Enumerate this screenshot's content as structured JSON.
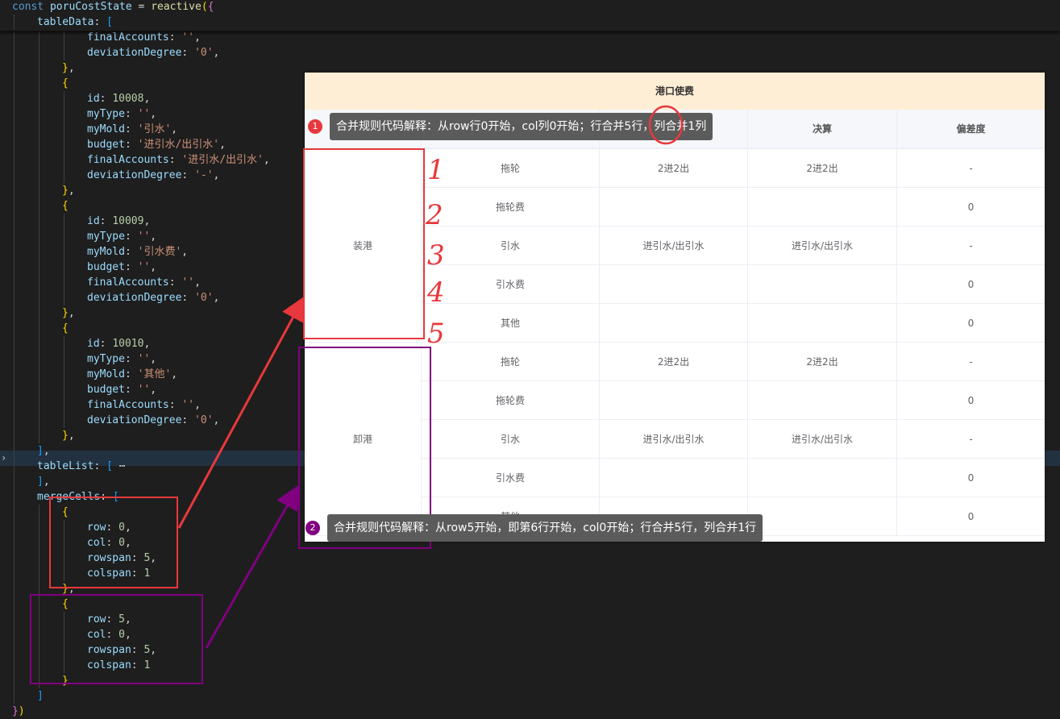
{
  "editor": {
    "lines": [
      {
        "indent": 0,
        "tokens": [
          [
            "kw",
            "const "
          ],
          [
            "var",
            "poruCostState"
          ],
          [
            "pun",
            " = "
          ],
          [
            "fn",
            "reactive"
          ],
          [
            "b1",
            "("
          ],
          [
            "b2",
            "{"
          ]
        ]
      },
      {
        "indent": 1,
        "tokens": [
          [
            "var",
            "tableData"
          ],
          [
            "pun",
            ": "
          ],
          [
            "b3",
            "["
          ]
        ]
      },
      {
        "indent": 3,
        "tokens": [
          [
            "var",
            "finalAccounts"
          ],
          [
            "pun",
            ": "
          ],
          [
            "str",
            "''"
          ],
          [
            "pun",
            ","
          ]
        ]
      },
      {
        "indent": 3,
        "tokens": [
          [
            "var",
            "deviationDegree"
          ],
          [
            "pun",
            ": "
          ],
          [
            "str",
            "'0'"
          ],
          [
            "pun",
            ","
          ]
        ]
      },
      {
        "indent": 2,
        "tokens": [
          [
            "b1",
            "}"
          ],
          [
            "pun",
            ","
          ]
        ]
      },
      {
        "indent": 2,
        "tokens": [
          [
            "b1",
            "{"
          ]
        ]
      },
      {
        "indent": 3,
        "tokens": [
          [
            "var",
            "id"
          ],
          [
            "pun",
            ": "
          ],
          [
            "num",
            "10008"
          ],
          [
            "pun",
            ","
          ]
        ]
      },
      {
        "indent": 3,
        "tokens": [
          [
            "var",
            "myType"
          ],
          [
            "pun",
            ": "
          ],
          [
            "str",
            "''"
          ],
          [
            "pun",
            ","
          ]
        ]
      },
      {
        "indent": 3,
        "tokens": [
          [
            "var",
            "myMold"
          ],
          [
            "pun",
            ": "
          ],
          [
            "str",
            "'引水'"
          ],
          [
            "pun",
            ","
          ]
        ]
      },
      {
        "indent": 3,
        "tokens": [
          [
            "var",
            "budget"
          ],
          [
            "pun",
            ": "
          ],
          [
            "str",
            "'进引水/出引水'"
          ],
          [
            "pun",
            ","
          ]
        ]
      },
      {
        "indent": 3,
        "tokens": [
          [
            "var",
            "finalAccounts"
          ],
          [
            "pun",
            ": "
          ],
          [
            "str",
            "'进引水/出引水'"
          ],
          [
            "pun",
            ","
          ]
        ]
      },
      {
        "indent": 3,
        "tokens": [
          [
            "var",
            "deviationDegree"
          ],
          [
            "pun",
            ": "
          ],
          [
            "str",
            "'-'"
          ],
          [
            "pun",
            ","
          ]
        ]
      },
      {
        "indent": 2,
        "tokens": [
          [
            "b1",
            "}"
          ],
          [
            "pun",
            ","
          ]
        ]
      },
      {
        "indent": 2,
        "tokens": [
          [
            "b1",
            "{"
          ]
        ]
      },
      {
        "indent": 3,
        "tokens": [
          [
            "var",
            "id"
          ],
          [
            "pun",
            ": "
          ],
          [
            "num",
            "10009"
          ],
          [
            "pun",
            ","
          ]
        ]
      },
      {
        "indent": 3,
        "tokens": [
          [
            "var",
            "myType"
          ],
          [
            "pun",
            ": "
          ],
          [
            "str",
            "''"
          ],
          [
            "pun",
            ","
          ]
        ]
      },
      {
        "indent": 3,
        "tokens": [
          [
            "var",
            "myMold"
          ],
          [
            "pun",
            ": "
          ],
          [
            "str",
            "'引水费'"
          ],
          [
            "pun",
            ","
          ]
        ]
      },
      {
        "indent": 3,
        "tokens": [
          [
            "var",
            "budget"
          ],
          [
            "pun",
            ": "
          ],
          [
            "str",
            "''"
          ],
          [
            "pun",
            ","
          ]
        ]
      },
      {
        "indent": 3,
        "tokens": [
          [
            "var",
            "finalAccounts"
          ],
          [
            "pun",
            ": "
          ],
          [
            "str",
            "''"
          ],
          [
            "pun",
            ","
          ]
        ]
      },
      {
        "indent": 3,
        "tokens": [
          [
            "var",
            "deviationDegree"
          ],
          [
            "pun",
            ": "
          ],
          [
            "str",
            "'0'"
          ],
          [
            "pun",
            ","
          ]
        ]
      },
      {
        "indent": 2,
        "tokens": [
          [
            "b1",
            "}"
          ],
          [
            "pun",
            ","
          ]
        ]
      },
      {
        "indent": 2,
        "tokens": [
          [
            "b1",
            "{"
          ]
        ]
      },
      {
        "indent": 3,
        "tokens": [
          [
            "var",
            "id"
          ],
          [
            "pun",
            ": "
          ],
          [
            "num",
            "10010"
          ],
          [
            "pun",
            ","
          ]
        ]
      },
      {
        "indent": 3,
        "tokens": [
          [
            "var",
            "myType"
          ],
          [
            "pun",
            ": "
          ],
          [
            "str",
            "''"
          ],
          [
            "pun",
            ","
          ]
        ]
      },
      {
        "indent": 3,
        "tokens": [
          [
            "var",
            "myMold"
          ],
          [
            "pun",
            ": "
          ],
          [
            "str",
            "'其他'"
          ],
          [
            "pun",
            ","
          ]
        ]
      },
      {
        "indent": 3,
        "tokens": [
          [
            "var",
            "budget"
          ],
          [
            "pun",
            ": "
          ],
          [
            "str",
            "''"
          ],
          [
            "pun",
            ","
          ]
        ]
      },
      {
        "indent": 3,
        "tokens": [
          [
            "var",
            "finalAccounts"
          ],
          [
            "pun",
            ": "
          ],
          [
            "str",
            "''"
          ],
          [
            "pun",
            ","
          ]
        ]
      },
      {
        "indent": 3,
        "tokens": [
          [
            "var",
            "deviationDegree"
          ],
          [
            "pun",
            ": "
          ],
          [
            "str",
            "'0'"
          ],
          [
            "pun",
            ","
          ]
        ]
      },
      {
        "indent": 2,
        "tokens": [
          [
            "b1",
            "}"
          ],
          [
            "pun",
            ","
          ]
        ]
      },
      {
        "indent": 1,
        "tokens": [
          [
            "b3",
            "]"
          ],
          [
            "pun",
            ","
          ]
        ]
      },
      {
        "indent": 1,
        "tokens": [
          [
            "var",
            "tableList"
          ],
          [
            "pun",
            ": "
          ],
          [
            "b3",
            "["
          ],
          [
            "pun",
            " ⋯"
          ]
        ]
      },
      {
        "indent": 1,
        "tokens": [
          [
            "b3",
            "]"
          ],
          [
            "pun",
            ","
          ]
        ]
      },
      {
        "indent": 1,
        "tokens": [
          [
            "var",
            "mergeCells"
          ],
          [
            "pun",
            ": "
          ],
          [
            "b3",
            "["
          ]
        ]
      },
      {
        "indent": 2,
        "tokens": [
          [
            "b1",
            "{"
          ]
        ]
      },
      {
        "indent": 3,
        "tokens": [
          [
            "var",
            "row"
          ],
          [
            "pun",
            ": "
          ],
          [
            "num",
            "0"
          ],
          [
            "pun",
            ","
          ]
        ]
      },
      {
        "indent": 3,
        "tokens": [
          [
            "var",
            "col"
          ],
          [
            "pun",
            ": "
          ],
          [
            "num",
            "0"
          ],
          [
            "pun",
            ","
          ]
        ]
      },
      {
        "indent": 3,
        "tokens": [
          [
            "var",
            "rowspan"
          ],
          [
            "pun",
            ": "
          ],
          [
            "num",
            "5"
          ],
          [
            "pun",
            ","
          ]
        ]
      },
      {
        "indent": 3,
        "tokens": [
          [
            "var",
            "colspan"
          ],
          [
            "pun",
            ": "
          ],
          [
            "num",
            "1"
          ]
        ]
      },
      {
        "indent": 2,
        "tokens": [
          [
            "b1",
            "}"
          ],
          [
            "pun",
            ","
          ]
        ]
      },
      {
        "indent": 2,
        "tokens": [
          [
            "b1",
            "{"
          ]
        ]
      },
      {
        "indent": 3,
        "tokens": [
          [
            "var",
            "row"
          ],
          [
            "pun",
            ": "
          ],
          [
            "num",
            "5"
          ],
          [
            "pun",
            ","
          ]
        ]
      },
      {
        "indent": 3,
        "tokens": [
          [
            "var",
            "col"
          ],
          [
            "pun",
            ": "
          ],
          [
            "num",
            "0"
          ],
          [
            "pun",
            ","
          ]
        ]
      },
      {
        "indent": 3,
        "tokens": [
          [
            "var",
            "rowspan"
          ],
          [
            "pun",
            ": "
          ],
          [
            "num",
            "5"
          ],
          [
            "pun",
            ","
          ]
        ]
      },
      {
        "indent": 3,
        "tokens": [
          [
            "var",
            "colspan"
          ],
          [
            "pun",
            ": "
          ],
          [
            "num",
            "1"
          ]
        ]
      },
      {
        "indent": 2,
        "tokens": [
          [
            "b1",
            "}"
          ]
        ]
      },
      {
        "indent": 1,
        "tokens": [
          [
            "b3",
            "]"
          ]
        ]
      },
      {
        "indent": 0,
        "tokens": [
          [
            "b2",
            "}"
          ],
          [
            "b1",
            ")"
          ]
        ]
      }
    ]
  },
  "table": {
    "title": "港口使费",
    "headers": [
      "",
      "",
      "",
      "决算",
      "偏差度"
    ],
    "groups": [
      "装港",
      "卸港"
    ],
    "rows": [
      [
        "拖轮",
        "2进2出",
        "2进2出",
        "-"
      ],
      [
        "拖轮费",
        "",
        "",
        "0"
      ],
      [
        "引水",
        "进引水/出引水",
        "进引水/出引水",
        "-"
      ],
      [
        "引水费",
        "",
        "",
        "0"
      ],
      [
        "其他",
        "",
        "",
        "0"
      ],
      [
        "拖轮",
        "2进2出",
        "2进2出",
        "-"
      ],
      [
        "拖轮费",
        "",
        "",
        "0"
      ],
      [
        "引水",
        "进引水/出引水",
        "进引水/出引水",
        "-"
      ],
      [
        "引水费",
        "",
        "",
        "0"
      ],
      [
        "其他",
        "",
        "",
        "0"
      ]
    ]
  },
  "annotations": {
    "tip1": {
      "badge": "1",
      "text": "合并规则代码解释：从row行0开始，col列0开始；行合并5行，列合并1列"
    },
    "tip2": {
      "badge": "2",
      "text": "合并规则代码解释：从row5开始，即第6行开始，col0开始；行合并5行，列合并1行"
    },
    "numerals": [
      "1",
      "2",
      "3",
      "4",
      "5"
    ],
    "colors": {
      "red": "#e8383d",
      "purple": "#800080",
      "tooltip_bg": "#5b5b5b"
    }
  }
}
